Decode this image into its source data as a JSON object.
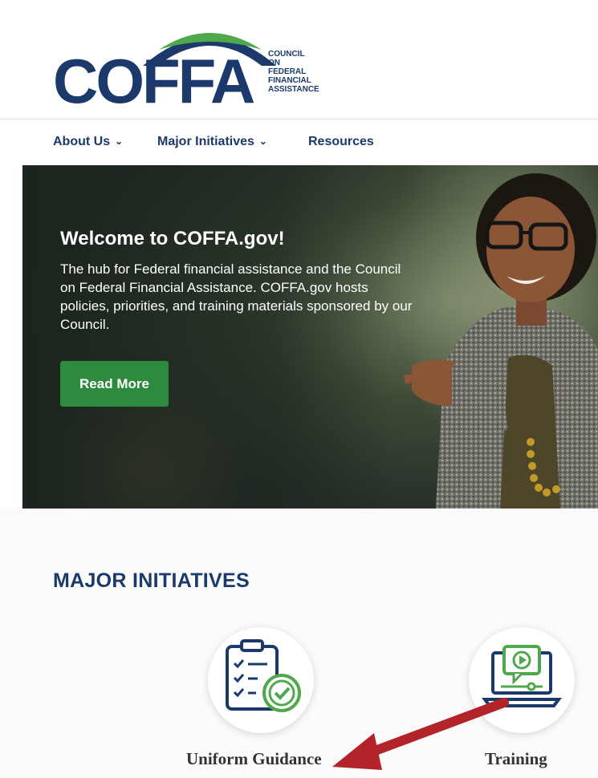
{
  "logo": {
    "wordmark": "COFFA",
    "tagline": [
      "COUNCIL",
      "ON",
      "FEDERAL",
      "FINANCIAL",
      "ASSISTANCE"
    ],
    "colors": {
      "navy": "#1b3a6b",
      "green": "#4fa84a",
      "blue": "#2b6cb0"
    }
  },
  "nav": {
    "items": [
      {
        "label": "About Us",
        "has_dropdown": true
      },
      {
        "label": "Major Initiatives",
        "has_dropdown": true
      },
      {
        "label": "Resources",
        "has_dropdown": false
      }
    ]
  },
  "hero": {
    "title": "Welcome to COFFA.gov!",
    "text": "The hub for Federal financial assistance and the Council on Federal Financial Assistance. COFFA.gov hosts policies, priorities, and training materials sponsored by our Council.",
    "button_label": "Read More",
    "button_color": "#2e8a3e"
  },
  "initiatives": {
    "title": "MAJOR INITIATIVES",
    "items": [
      {
        "label": "Uniform Guidance",
        "icon": "checklist-icon"
      },
      {
        "label": "Training",
        "icon": "video-laptop-icon"
      }
    ]
  },
  "annotation": {
    "arrow_color": "#b3242a",
    "points_to": "Uniform Guidance"
  }
}
